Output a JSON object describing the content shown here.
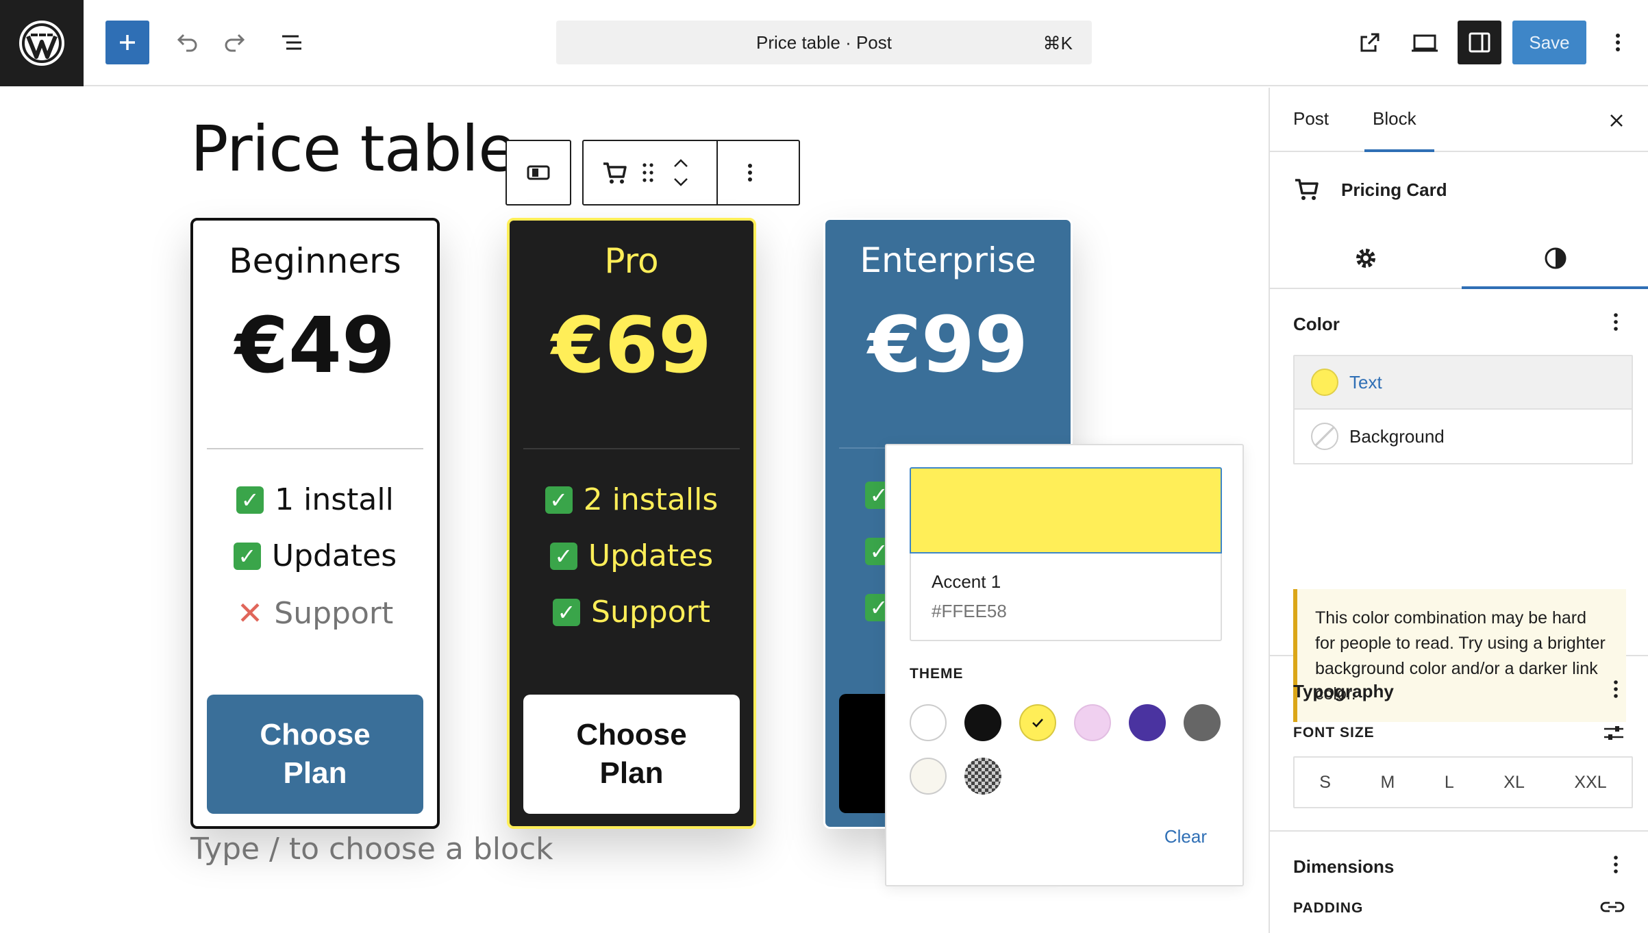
{
  "header": {
    "document_title": "Price table · Post",
    "shortcut": "⌘K",
    "save_label": "Save",
    "icons": [
      "wordpress-logo",
      "plus-icon",
      "undo-icon",
      "redo-icon",
      "list-view-icon",
      "external-link-icon",
      "desktop-preview-icon",
      "sidebar-icon",
      "more-vertical-icon"
    ]
  },
  "editor": {
    "page_title": "Price table",
    "placeholder": "Type / to choose a block",
    "cards": [
      {
        "plan": "Beginners",
        "price": "€49",
        "features": [
          {
            "mark": "check",
            "text": "1 install"
          },
          {
            "mark": "check",
            "text": "Updates"
          },
          {
            "mark": "cross",
            "text": "Support"
          }
        ],
        "cta": "Choose Plan",
        "colors": {
          "bg": "#ffffff",
          "text": "#111111",
          "border": "#111111",
          "cta_bg": "#3a6f99",
          "cta_text": "#ffffff"
        }
      },
      {
        "plan": "Pro",
        "price": "€69",
        "features": [
          {
            "mark": "check",
            "text": "2 installs"
          },
          {
            "mark": "check",
            "text": "Updates"
          },
          {
            "mark": "check",
            "text": "Support"
          }
        ],
        "cta": "Choose Plan",
        "colors": {
          "bg": "#1e1e1e",
          "text": "#ffee58",
          "border": "#ffee58",
          "cta_bg": "#ffffff",
          "cta_text": "#111111"
        }
      },
      {
        "plan": "Enterprise",
        "price": "€99",
        "colors": {
          "bg": "#3a6f99",
          "text": "#ffffff",
          "border": "#ffffff",
          "cta_bg": "#000000"
        }
      }
    ]
  },
  "color_popover": {
    "selected_name": "Accent 1",
    "selected_hex": "#FFEE58",
    "theme_label": "THEME",
    "palette": [
      "#ffffff",
      "#111111",
      "#ffee58",
      "#f0d0f0",
      "#4a33a0",
      "#666666",
      "#f8f6ee",
      "checkered"
    ],
    "selected_index": 2,
    "clear_label": "Clear"
  },
  "sidebar": {
    "tabs": [
      "Post",
      "Block"
    ],
    "active_tab": "Block",
    "block_name": "Pricing Card",
    "color_section": {
      "title": "Color",
      "items": [
        {
          "label": "Text",
          "swatch": "#ffee58",
          "active": true
        },
        {
          "label": "Background",
          "swatch": "none",
          "active": false
        }
      ],
      "notice": "This color combination may be hard for people to read. Try using a brighter background color and/or a darker link color."
    },
    "typography": {
      "title": "Typography",
      "font_size_label": "FONT SIZE",
      "sizes": [
        "S",
        "M",
        "L",
        "XL",
        "XXL"
      ]
    },
    "dimensions": {
      "title": "Dimensions",
      "padding_label": "PADDING"
    }
  }
}
